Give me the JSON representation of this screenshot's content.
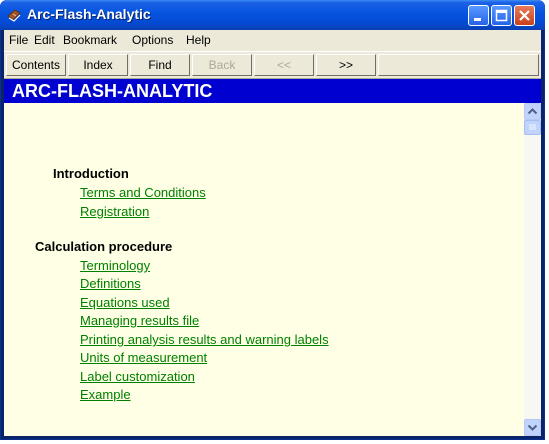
{
  "window": {
    "title": "Arc-Flash-Analytic"
  },
  "menu": [
    {
      "label": "File"
    },
    {
      "label": "Edit"
    },
    {
      "label": "Bookmark"
    },
    {
      "label": "Options"
    },
    {
      "label": "Help"
    }
  ],
  "toolbar": {
    "contents": "Contents",
    "index": "Index",
    "find": "Find",
    "back": "Back",
    "prev": "<<",
    "next": ">>"
  },
  "page": {
    "header": "ARC-FLASH-ANALYTIC",
    "sections": [
      {
        "heading": "Introduction",
        "links": [
          "Terms and Conditions",
          "Registration"
        ]
      },
      {
        "heading": "Calculation procedure",
        "links": [
          "Terminology",
          "Definitions",
          "Equations used",
          "Managing results file",
          "Printing  analysis results and warning labels",
          "Units of measurement",
          "Label customization",
          "Example"
        ]
      }
    ]
  },
  "colors": {
    "link": "#008000",
    "header_bg": "#0000d0",
    "content_bg": "#ffffe5"
  }
}
